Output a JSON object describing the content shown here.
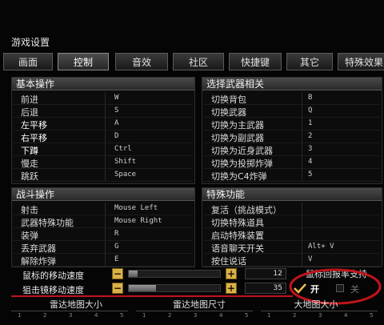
{
  "window": {
    "title": "游戏设置"
  },
  "tabs": [
    "画面",
    "控制",
    "音效",
    "社区",
    "快捷键",
    "其它",
    "特殊效果"
  ],
  "basic": {
    "header": "基本操作",
    "rows": [
      {
        "name": "前进",
        "key": "W"
      },
      {
        "name": "后退",
        "key": "S"
      },
      {
        "name": "左平移",
        "key": "A"
      },
      {
        "name": "右平移",
        "key": "D"
      },
      {
        "name": "下蹲",
        "key": "Ctrl"
      },
      {
        "name": "慢走",
        "key": "Shift"
      },
      {
        "name": "跳跃",
        "key": "Space"
      }
    ]
  },
  "weapon": {
    "header": "选择武器相关",
    "rows": [
      {
        "name": "切换背包",
        "key": "B"
      },
      {
        "name": "切换武器",
        "key": "Q"
      },
      {
        "name": "切换为主武器",
        "key": "1"
      },
      {
        "name": "切换为副武器",
        "key": "2"
      },
      {
        "name": "切换为近身武器",
        "key": "3"
      },
      {
        "name": "切换为投掷炸弹",
        "key": "4"
      },
      {
        "name": "切换为C4炸弹",
        "key": "5"
      }
    ]
  },
  "combat": {
    "header": "战斗操作",
    "rows": [
      {
        "name": "射击",
        "key": "Mouse Left"
      },
      {
        "name": "武器特殊功能",
        "key": "Mouse Right"
      },
      {
        "name": "装弹",
        "key": "R"
      },
      {
        "name": "丢弃武器",
        "key": "G"
      },
      {
        "name": "解除炸弹",
        "key": "E"
      }
    ]
  },
  "special": {
    "header": "特殊功能",
    "rows": [
      {
        "name": "复活（挑战模式）",
        "key": ""
      },
      {
        "name": "切换特殊道具",
        "key": ""
      },
      {
        "name": "启动特殊装置",
        "key": ""
      },
      {
        "name": "语音聊天开关",
        "key": "Alt+ V"
      },
      {
        "name": "按住说话",
        "key": "V"
      }
    ]
  },
  "sliders": [
    {
      "label": "鼠标的移动速度",
      "minus": "−",
      "plus": "+",
      "value": "12",
      "fraction": 0.1
    },
    {
      "label": "狙击镜移动速度",
      "minus": "−",
      "plus": "+",
      "value": "35",
      "fraction": 0.3
    }
  ],
  "polling": {
    "label": "鼠标回报率支持",
    "on": "开",
    "off": "关"
  },
  "radar": [
    "雷达地图大小",
    "雷达地图尺寸",
    "大地图大小"
  ],
  "ruler_ticks": [
    "1",
    "2",
    "3",
    "4",
    "5"
  ],
  "colors": {
    "accent": "#d9b24a",
    "annotation": "#c0141c",
    "header": "#3a3a3a"
  }
}
